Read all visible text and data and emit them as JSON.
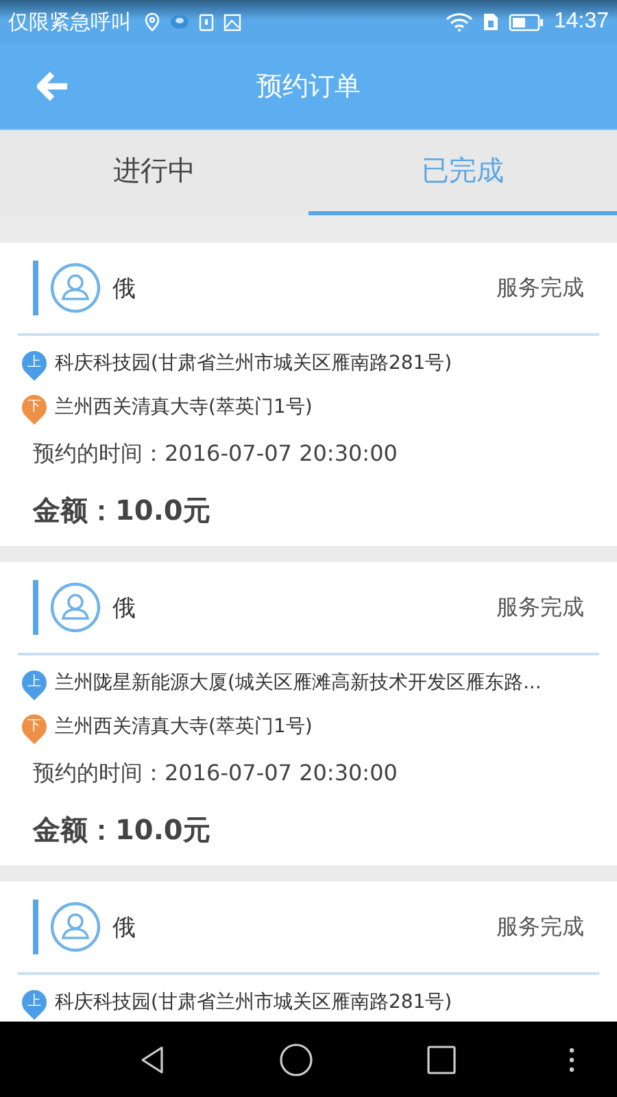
{
  "status_bar": {
    "carrier": "仅限紧急呼叫",
    "time": "14:37"
  },
  "header": {
    "title": "预约订单"
  },
  "tabs": [
    {
      "label": "进行中",
      "selected": false
    },
    {
      "label": "已完成",
      "selected": true
    }
  ],
  "orders": [
    {
      "name": "俄",
      "status": "服务完成",
      "stops": [
        {
          "kind": "pickup",
          "marker": "上",
          "address": "科庆科技园(甘肃省兰州市城关区雁南路281号)"
        },
        {
          "kind": "dropoff",
          "marker": "下",
          "address": "兰州西关清真大寺(萃英门1号)"
        }
      ],
      "time_label": "预约的时间：",
      "time": "2016-07-07 20:30:00",
      "amount_label": "金额：",
      "amount": "10.0元"
    },
    {
      "name": "俄",
      "status": "服务完成",
      "stops": [
        {
          "kind": "pickup",
          "marker": "上",
          "address": "兰州陇星新能源大厦(城关区雁滩高新技术开发区雁东路..."
        },
        {
          "kind": "dropoff",
          "marker": "下",
          "address": "兰州西关清真大寺(萃英门1号)"
        }
      ],
      "time_label": "预约的时间：",
      "time": "2016-07-07 20:30:00",
      "amount_label": "金额：",
      "amount": "10.0元"
    },
    {
      "name": "俄",
      "status": "服务完成",
      "stops": [
        {
          "kind": "pickup",
          "marker": "上",
          "address": "科庆科技园(甘肃省兰州市城关区雁南路281号)"
        }
      ]
    }
  ]
}
